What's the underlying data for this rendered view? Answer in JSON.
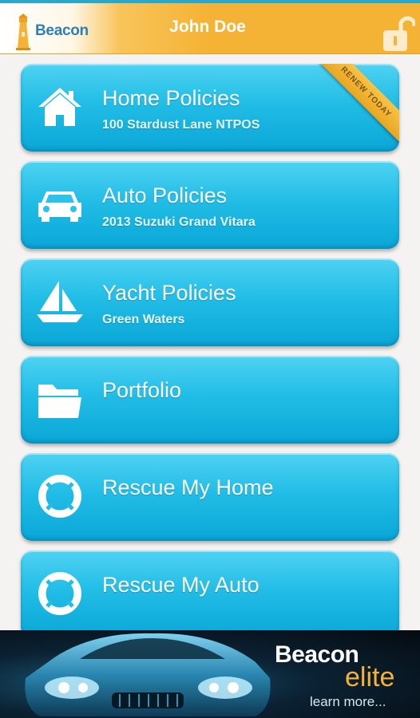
{
  "header": {
    "brand": "Beacon",
    "user_name": "John Doe",
    "lock_icon": "unlocked-padlock-icon",
    "colors": {
      "bar": "#f5b335",
      "brand_text": "#2c7fb8"
    }
  },
  "menu": {
    "items": [
      {
        "title": "Home Policies",
        "subtitle": "100 Stardust Lane NTPOS",
        "icon": "house-icon",
        "ribbon": "RENEW TODAY"
      },
      {
        "title": "Auto Policies",
        "subtitle": "2013 Suzuki Grand Vitara",
        "icon": "car-icon"
      },
      {
        "title": "Yacht Policies",
        "subtitle": "Green Waters",
        "icon": "sailboat-icon"
      },
      {
        "title": "Portfolio",
        "icon": "folder-icon"
      },
      {
        "title": "Rescue My Home",
        "icon": "lifebuoy-icon"
      },
      {
        "title": "Rescue My Auto",
        "icon": "lifebuoy-icon"
      }
    ],
    "colors": {
      "card_top": "#4fd2f2",
      "card_bottom": "#0aa6d6",
      "ribbon": "#f5b335"
    }
  },
  "ad": {
    "brand": "Beacon",
    "product": "elite",
    "cta": "learn more..."
  }
}
